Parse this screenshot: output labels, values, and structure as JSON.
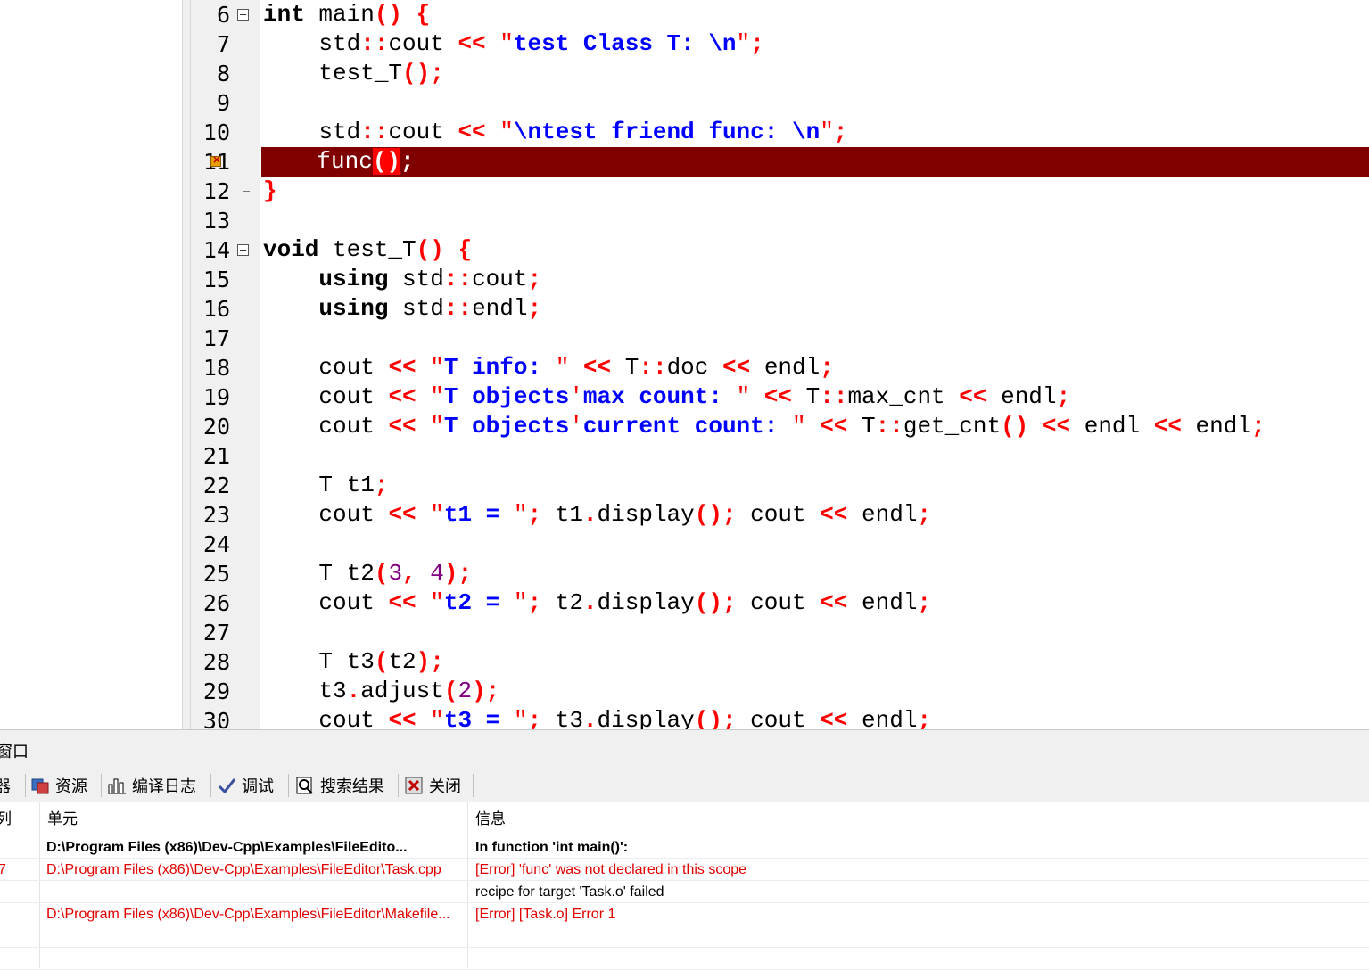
{
  "editor": {
    "lines": [
      {
        "n": "6",
        "tokens": [
          [
            "kw",
            "int"
          ],
          [
            "id",
            " main"
          ],
          [
            "op",
            "()"
          ],
          [
            "id",
            " "
          ],
          [
            "op",
            "{"
          ]
        ]
      },
      {
        "n": "7",
        "tokens": [
          [
            "id",
            "    std"
          ],
          [
            "op",
            "::"
          ],
          [
            "id",
            "cout "
          ],
          [
            "op",
            "<<"
          ],
          [
            "id",
            " "
          ],
          [
            "strq",
            "\""
          ],
          [
            "str",
            "test Class T: "
          ],
          [
            "esc",
            "\\n"
          ],
          [
            "strq",
            "\""
          ],
          [
            "op",
            ";"
          ]
        ]
      },
      {
        "n": "8",
        "tokens": [
          [
            "id",
            "    test_T"
          ],
          [
            "op",
            "();"
          ]
        ]
      },
      {
        "n": "9",
        "tokens": []
      },
      {
        "n": "10",
        "tokens": [
          [
            "id",
            "    std"
          ],
          [
            "op",
            "::"
          ],
          [
            "id",
            "cout "
          ],
          [
            "op",
            "<<"
          ],
          [
            "id",
            " "
          ],
          [
            "strq",
            "\""
          ],
          [
            "esc",
            "\\n"
          ],
          [
            "str",
            "test friend func: "
          ],
          [
            "esc",
            "\\n"
          ],
          [
            "strq",
            "\""
          ],
          [
            "op",
            ";"
          ]
        ]
      },
      {
        "n": "11",
        "tokens": [
          [
            "id",
            "    func"
          ],
          [
            "paren",
            "()"
          ],
          [
            "op",
            ";"
          ]
        ]
      },
      {
        "n": "12",
        "tokens": [
          [
            "op",
            "}"
          ]
        ]
      },
      {
        "n": "13",
        "tokens": []
      },
      {
        "n": "14",
        "tokens": [
          [
            "kw",
            "void"
          ],
          [
            "id",
            " test_T"
          ],
          [
            "op",
            "()"
          ],
          [
            "id",
            " "
          ],
          [
            "op",
            "{"
          ]
        ]
      },
      {
        "n": "15",
        "tokens": [
          [
            "id",
            "    "
          ],
          [
            "kw",
            "using"
          ],
          [
            "id",
            " std"
          ],
          [
            "op",
            "::"
          ],
          [
            "id",
            "cout"
          ],
          [
            "op",
            ";"
          ]
        ]
      },
      {
        "n": "16",
        "tokens": [
          [
            "id",
            "    "
          ],
          [
            "kw",
            "using"
          ],
          [
            "id",
            " std"
          ],
          [
            "op",
            "::"
          ],
          [
            "id",
            "endl"
          ],
          [
            "op",
            ";"
          ]
        ]
      },
      {
        "n": "17",
        "tokens": []
      },
      {
        "n": "18",
        "tokens": [
          [
            "id",
            "    cout "
          ],
          [
            "op",
            "<<"
          ],
          [
            "id",
            " "
          ],
          [
            "strq",
            "\""
          ],
          [
            "str",
            "T info: "
          ],
          [
            "strq",
            "\""
          ],
          [
            "id",
            " "
          ],
          [
            "op",
            "<<"
          ],
          [
            "id",
            " T"
          ],
          [
            "op",
            "::"
          ],
          [
            "id",
            "doc "
          ],
          [
            "op",
            "<<"
          ],
          [
            "id",
            " endl"
          ],
          [
            "op",
            ";"
          ]
        ]
      },
      {
        "n": "19",
        "tokens": [
          [
            "id",
            "    cout "
          ],
          [
            "op",
            "<<"
          ],
          [
            "id",
            " "
          ],
          [
            "strq",
            "\""
          ],
          [
            "str",
            "T objects"
          ],
          [
            "strq",
            "'"
          ],
          [
            "str",
            "max count: "
          ],
          [
            "strq",
            "\""
          ],
          [
            "id",
            " "
          ],
          [
            "op",
            "<<"
          ],
          [
            "id",
            " T"
          ],
          [
            "op",
            "::"
          ],
          [
            "id",
            "max_cnt "
          ],
          [
            "op",
            "<<"
          ],
          [
            "id",
            " endl"
          ],
          [
            "op",
            ";"
          ]
        ]
      },
      {
        "n": "20",
        "tokens": [
          [
            "id",
            "    cout "
          ],
          [
            "op",
            "<<"
          ],
          [
            "id",
            " "
          ],
          [
            "strq",
            "\""
          ],
          [
            "str",
            "T objects"
          ],
          [
            "strq",
            "'"
          ],
          [
            "str",
            "current count: "
          ],
          [
            "strq",
            "\""
          ],
          [
            "id",
            " "
          ],
          [
            "op",
            "<<"
          ],
          [
            "id",
            " T"
          ],
          [
            "op",
            "::"
          ],
          [
            "id",
            "get_cnt"
          ],
          [
            "op",
            "()"
          ],
          [
            "id",
            " "
          ],
          [
            "op",
            "<<"
          ],
          [
            "id",
            " endl "
          ],
          [
            "op",
            "<<"
          ],
          [
            "id",
            " endl"
          ],
          [
            "op",
            ";"
          ]
        ]
      },
      {
        "n": "21",
        "tokens": []
      },
      {
        "n": "22",
        "tokens": [
          [
            "id",
            "    T t1"
          ],
          [
            "op",
            ";"
          ]
        ]
      },
      {
        "n": "23",
        "tokens": [
          [
            "id",
            "    cout "
          ],
          [
            "op",
            "<<"
          ],
          [
            "id",
            " "
          ],
          [
            "strq",
            "\""
          ],
          [
            "str",
            "t1 = "
          ],
          [
            "strq",
            "\""
          ],
          [
            "op",
            ";"
          ],
          [
            "id",
            " t1"
          ],
          [
            "op",
            "."
          ],
          [
            "id",
            "display"
          ],
          [
            "op",
            "();"
          ],
          [
            "id",
            " cout "
          ],
          [
            "op",
            "<<"
          ],
          [
            "id",
            " endl"
          ],
          [
            "op",
            ";"
          ]
        ]
      },
      {
        "n": "24",
        "tokens": []
      },
      {
        "n": "25",
        "tokens": [
          [
            "id",
            "    T t2"
          ],
          [
            "op",
            "("
          ],
          [
            "num",
            "3"
          ],
          [
            "op",
            ","
          ],
          [
            "id",
            " "
          ],
          [
            "num",
            "4"
          ],
          [
            "op",
            ");"
          ]
        ]
      },
      {
        "n": "26",
        "tokens": [
          [
            "id",
            "    cout "
          ],
          [
            "op",
            "<<"
          ],
          [
            "id",
            " "
          ],
          [
            "strq",
            "\""
          ],
          [
            "str",
            "t2 = "
          ],
          [
            "strq",
            "\""
          ],
          [
            "op",
            ";"
          ],
          [
            "id",
            " t2"
          ],
          [
            "op",
            "."
          ],
          [
            "id",
            "display"
          ],
          [
            "op",
            "();"
          ],
          [
            "id",
            " cout "
          ],
          [
            "op",
            "<<"
          ],
          [
            "id",
            " endl"
          ],
          [
            "op",
            ";"
          ]
        ]
      },
      {
        "n": "27",
        "tokens": []
      },
      {
        "n": "28",
        "tokens": [
          [
            "id",
            "    T t3"
          ],
          [
            "op",
            "("
          ],
          [
            "id",
            "t2"
          ],
          [
            "op",
            ");"
          ]
        ]
      },
      {
        "n": "29",
        "tokens": [
          [
            "id",
            "    t3"
          ],
          [
            "op",
            "."
          ],
          [
            "id",
            "adjust"
          ],
          [
            "op",
            "("
          ],
          [
            "num",
            "2"
          ],
          [
            "op",
            ");"
          ]
        ]
      },
      {
        "n": "30",
        "tokens": [
          [
            "id",
            "    cout "
          ],
          [
            "op",
            "<<"
          ],
          [
            "id",
            " "
          ],
          [
            "strq",
            "\""
          ],
          [
            "str",
            "t3 = "
          ],
          [
            "strq",
            "\""
          ],
          [
            "op",
            ";"
          ],
          [
            "id",
            " t3"
          ],
          [
            "op",
            "."
          ],
          [
            "id",
            "display"
          ],
          [
            "op",
            "();"
          ],
          [
            "id",
            " cout "
          ],
          [
            "op",
            "<<"
          ],
          [
            "id",
            " endl"
          ],
          [
            "op",
            ";"
          ]
        ]
      }
    ],
    "error_line": "11",
    "colors": {
      "error_bg": "#800000",
      "operator": "#ff0000",
      "string": "#0000ff",
      "number": "#800080"
    }
  },
  "panel": {
    "title": "窗口",
    "tabs": [
      {
        "label": "器",
        "icon": "compiler-icon"
      },
      {
        "label": "资源",
        "icon": "resources-icon"
      },
      {
        "label": "编译日志",
        "icon": "bar-chart-icon"
      },
      {
        "label": "调试",
        "icon": "checkmark-icon"
      },
      {
        "label": "搜索结果",
        "icon": "search-results-icon"
      },
      {
        "label": "关闭",
        "icon": "close-icon"
      }
    ],
    "columns": [
      "列",
      "单元",
      "信息"
    ],
    "rows": [
      {
        "col": "",
        "unit": "D:\\Program Files (x86)\\Dev-Cpp\\Examples\\FileEdito...",
        "msg": "In function 'int main()':",
        "style": "bold"
      },
      {
        "col": "7",
        "unit": "D:\\Program Files (x86)\\Dev-Cpp\\Examples\\FileEditor\\Task.cpp",
        "msg": "[Error] 'func' was not declared in this scope",
        "style": "red"
      },
      {
        "col": "",
        "unit": "",
        "msg": "recipe for target 'Task.o' failed",
        "style": "blk"
      },
      {
        "col": "",
        "unit": "D:\\Program Files (x86)\\Dev-Cpp\\Examples\\FileEditor\\Makefile...",
        "msg": "[Error] [Task.o] Error 1",
        "style": "red"
      },
      {
        "col": "",
        "unit": "",
        "msg": "",
        "style": "blk"
      },
      {
        "col": "",
        "unit": "",
        "msg": "",
        "style": "blk"
      }
    ]
  }
}
